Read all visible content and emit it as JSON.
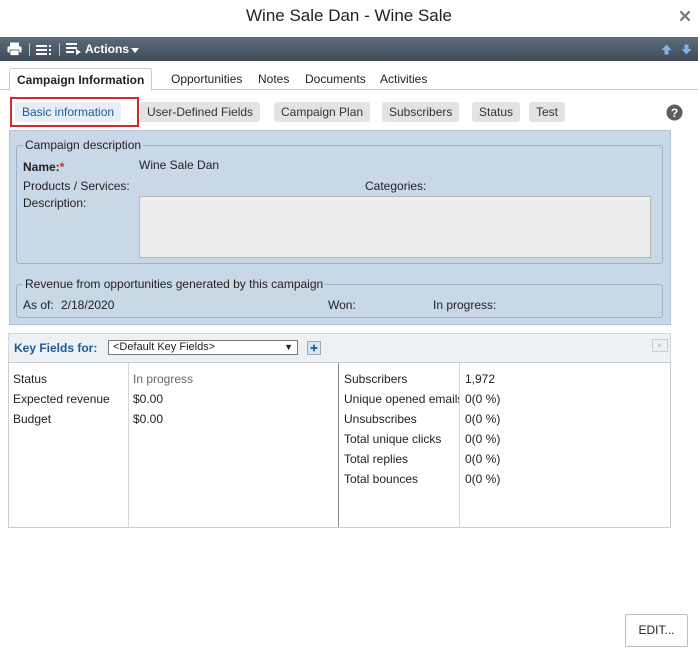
{
  "window": {
    "title": "Wine Sale Dan - Wine Sale"
  },
  "toolbar": {
    "actions_label": "Actions"
  },
  "tabs": [
    {
      "label": "Campaign Information",
      "active": true
    },
    {
      "label": "Opportunities"
    },
    {
      "label": "Notes"
    },
    {
      "label": "Documents"
    },
    {
      "label": "Activities"
    }
  ],
  "subtabs": [
    {
      "label": "Basic information",
      "active": true
    },
    {
      "label": "User-Defined Fields"
    },
    {
      "label": "Campaign Plan"
    },
    {
      "label": "Subscribers"
    },
    {
      "label": "Status"
    },
    {
      "label": "Test"
    }
  ],
  "campaign_description": {
    "legend": "Campaign description",
    "name_label": "Name:",
    "required_marker": "*",
    "name_value": "Wine Sale Dan",
    "products_label": "Products / Services:",
    "categories_label": "Categories:",
    "description_label": "Description:"
  },
  "revenue": {
    "legend": "Revenue from opportunities generated by this campaign",
    "as_of_label": "As of:",
    "as_of_value": "2/18/2020",
    "won_label": "Won:",
    "in_progress_label": "In progress:"
  },
  "key_fields": {
    "label": "Key Fields for:",
    "selected": "<Default Key Fields>"
  },
  "left_fields": [
    {
      "label": "Status",
      "value": "In progress"
    },
    {
      "label": "Expected revenue",
      "value": "$0.00"
    },
    {
      "label": "Budget",
      "value": "$0.00"
    }
  ],
  "right_fields": [
    {
      "label": "Subscribers",
      "value": "1,972"
    },
    {
      "label": "Unique opened emails",
      "value": "0(0 %)"
    },
    {
      "label": "Unsubscribes",
      "value": "0(0 %)"
    },
    {
      "label": "Total unique clicks",
      "value": "0(0 %)"
    },
    {
      "label": "Total replies",
      "value": "0(0 %)"
    },
    {
      "label": "Total bounces",
      "value": "0(0 %)"
    }
  ],
  "edit_button": {
    "label": "EDIT..."
  },
  "colors": {
    "accent": "#1f5a96",
    "highlight": "#d9262c",
    "panel": "#c8d8e6",
    "toolbar": "#4a5664"
  },
  "icons": [
    "close-icon",
    "print-icon",
    "list-icon",
    "list-settings-icon",
    "chevron-down-icon",
    "arrow-up-icon",
    "arrow-down-icon",
    "help-icon",
    "add-icon",
    "panel-icon"
  ]
}
